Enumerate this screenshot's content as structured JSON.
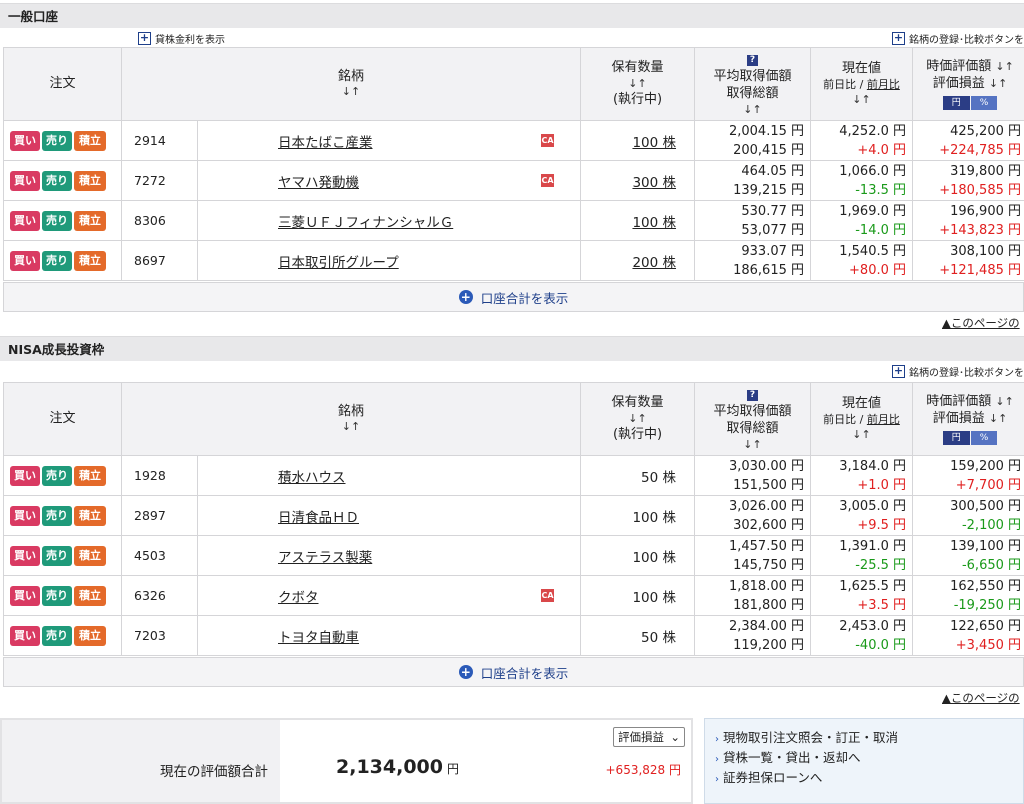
{
  "sections": [
    {
      "title": "一般口座",
      "lending_link": "貸株金利を表示",
      "register_link": "銘柄の登録･比較ボタンを",
      "headers": {
        "order": "注文",
        "name": "銘柄",
        "qty_line1": "保有数量",
        "qty_line3": "(執行中)",
        "avg_line1": "平均取得価額",
        "avg_line2": "取得総額",
        "price_line1": "現在値",
        "price_prev_day": "前日比",
        "price_sep": " / ",
        "price_prev_month": "前月比",
        "val_line1": "時価評価額",
        "val_line2": "評価損益",
        "yen": "円",
        "pct": "%"
      },
      "buttons": {
        "buy": "買い",
        "sell": "売り",
        "tsumi": "積立"
      },
      "rows": [
        {
          "code": "2914",
          "name": "日本たばこ産業",
          "badge": "CA",
          "qty": "100 株",
          "qty_link": true,
          "avg": "2,004.15 円",
          "total": "200,415 円",
          "price": "4,252.0 円",
          "change": "+4.0 円",
          "value": "425,200 円",
          "pl": "+224,785 円"
        },
        {
          "code": "7272",
          "name": "ヤマハ発動機",
          "badge": "CA",
          "qty": "300 株",
          "qty_link": true,
          "avg": "464.05 円",
          "total": "139,215 円",
          "price": "1,066.0 円",
          "change": "-13.5 円",
          "value": "319,800 円",
          "pl": "+180,585 円"
        },
        {
          "code": "8306",
          "name": "三菱ＵＦＪフィナンシャルＧ",
          "badge": "",
          "qty": "100 株",
          "qty_link": true,
          "avg": "530.77 円",
          "total": "53,077 円",
          "price": "1,969.0 円",
          "change": "-14.0 円",
          "value": "196,900 円",
          "pl": "+143,823 円"
        },
        {
          "code": "8697",
          "name": "日本取引所グループ",
          "badge": "",
          "qty": "200 株",
          "qty_link": true,
          "avg": "933.07 円",
          "total": "186,615 円",
          "price": "1,540.5 円",
          "change": "+80.0 円",
          "value": "308,100 円",
          "pl": "+121,485 円"
        }
      ],
      "sum_link": "口座合計を表示",
      "top_link": "▲このページの"
    },
    {
      "title": "NISA成長投資枠",
      "register_link": "銘柄の登録･比較ボタンを",
      "headers": {
        "order": "注文",
        "name": "銘柄",
        "qty_line1": "保有数量",
        "qty_line3": "(執行中)",
        "avg_line1": "平均取得価額",
        "avg_line2": "取得総額",
        "price_line1": "現在値",
        "price_prev_day": "前日比",
        "price_sep": " / ",
        "price_prev_month": "前月比",
        "val_line1": "時価評価額",
        "val_line2": "評価損益",
        "yen": "円",
        "pct": "%"
      },
      "buttons": {
        "buy": "買い",
        "sell": "売り",
        "tsumi": "積立"
      },
      "rows": [
        {
          "code": "1928",
          "name": "積水ハウス",
          "badge": "",
          "qty": "50 株",
          "qty_link": false,
          "avg": "3,030.00 円",
          "total": "151,500 円",
          "price": "3,184.0 円",
          "change": "+1.0 円",
          "value": "159,200 円",
          "pl": "+7,700 円"
        },
        {
          "code": "2897",
          "name": "日清食品ＨＤ",
          "badge": "",
          "qty": "100 株",
          "qty_link": false,
          "avg": "3,026.00 円",
          "total": "302,600 円",
          "price": "3,005.0 円",
          "change": "+9.5 円",
          "value": "300,500 円",
          "pl": "-2,100 円"
        },
        {
          "code": "4503",
          "name": "アステラス製薬",
          "badge": "",
          "qty": "100 株",
          "qty_link": false,
          "avg": "1,457.50 円",
          "total": "145,750 円",
          "price": "1,391.0 円",
          "change": "-25.5 円",
          "value": "139,100 円",
          "pl": "-6,650 円"
        },
        {
          "code": "6326",
          "name": "クボタ",
          "badge": "CA",
          "qty": "100 株",
          "qty_link": false,
          "avg": "1,818.00 円",
          "total": "181,800 円",
          "price": "1,625.5 円",
          "change": "+3.5 円",
          "value": "162,550 円",
          "pl": "-19,250 円"
        },
        {
          "code": "7203",
          "name": "トヨタ自動車",
          "badge": "",
          "qty": "50 株",
          "qty_link": false,
          "avg": "2,384.00 円",
          "total": "119,200 円",
          "price": "2,453.0 円",
          "change": "-40.0 円",
          "value": "122,650 円",
          "pl": "+3,450 円"
        }
      ],
      "sum_link": "口座合計を表示",
      "top_link": "▲このページの"
    }
  ],
  "total": {
    "label": "現在の評価額合計",
    "value": "2,134,000",
    "unit": "円",
    "select_value": "評価損益",
    "pl": "+653,828 円"
  },
  "links": [
    "現物取引注文照会・訂正・取消",
    "貸株一覧・貸出・返却へ",
    "証券担保ローンへ"
  ],
  "icons": {
    "help": "help-icon",
    "plus": "plus-icon",
    "add": "circle-plus-icon"
  },
  "colors": {
    "positive": "#e02020",
    "negative": "#1a9a1a",
    "buy": "#d93a62",
    "sell": "#1f9a7a",
    "tsumi": "#e46a2a"
  }
}
